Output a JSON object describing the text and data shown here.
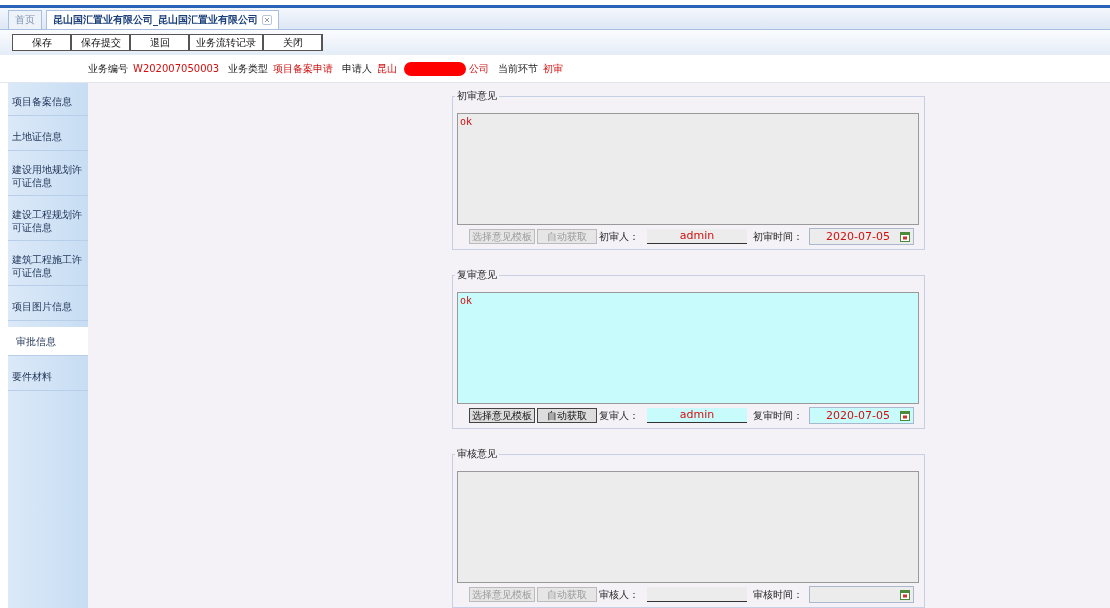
{
  "tabs": [
    {
      "label": "首页",
      "selected": false,
      "closable": false
    },
    {
      "label": "昆山国汇置业有限公司_昆山国汇置业有限公司",
      "selected": true,
      "closable": true
    }
  ],
  "toolbar": [
    "保存",
    "保存提交",
    "退回",
    "业务流转记录",
    "关闭"
  ],
  "info": [
    {
      "label": "业务编号",
      "value": "W202007050003"
    },
    {
      "label": "业务类型",
      "value": "项目备案申请"
    },
    {
      "label": "申请人",
      "value": "昆山",
      "redacted": true,
      "value_after": "公司"
    },
    {
      "label": "当前环节",
      "value": "初审"
    }
  ],
  "sidebar": [
    {
      "label": "项目备案信息",
      "selected": false
    },
    {
      "label": "土地证信息",
      "selected": false
    },
    {
      "label": "建设用地规划许可证信息",
      "selected": false
    },
    {
      "label": "建设工程规划许可证信息",
      "selected": false
    },
    {
      "label": "建筑工程施工许可证信息",
      "selected": false
    },
    {
      "label": "项目图片信息",
      "selected": false
    },
    {
      "label": "审批信息",
      "selected": true
    },
    {
      "label": "要件材料",
      "selected": false
    }
  ],
  "sections": [
    {
      "legend": "初审意见",
      "enabled": false,
      "opinion": "ok",
      "template_button": "选择意见模板",
      "auto_button": "自动获取",
      "person_label": "初审人：",
      "person": "admin",
      "time_label": "初审时间：",
      "time": "2020-07-05"
    },
    {
      "legend": "复审意见",
      "enabled": true,
      "opinion": "ok",
      "template_button": "选择意见模板",
      "auto_button": "自动获取",
      "person_label": "复审人：",
      "person": "admin",
      "time_label": "复审时间：",
      "time": "2020-07-05"
    },
    {
      "legend": "审核意见",
      "enabled": false,
      "template_button": "选择意见模板",
      "auto_button": "自动获取",
      "person_label": "审核人：",
      "time_label": "审核时间："
    }
  ]
}
